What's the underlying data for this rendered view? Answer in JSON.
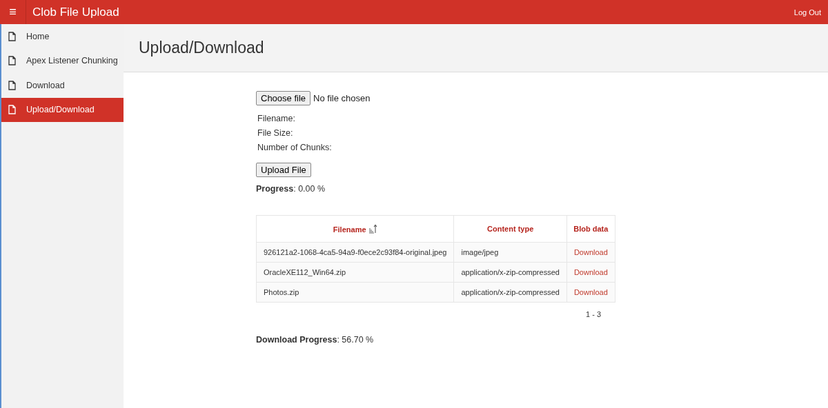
{
  "header": {
    "menu_glyph": "≡",
    "title": "Clob File Upload",
    "logout": "Log Out"
  },
  "sidebar": {
    "items": [
      {
        "label": "Home",
        "selected": false
      },
      {
        "label": "Apex Listener Chunking",
        "selected": false
      },
      {
        "label": "Download",
        "selected": false
      },
      {
        "label": "Upload/Download",
        "selected": true
      }
    ]
  },
  "page_title": "Upload/Download",
  "file_input": {
    "button": "Choose file",
    "status": "No file chosen"
  },
  "info_lines": [
    "Filename:",
    "File Size:",
    "Number of Chunks:"
  ],
  "upload_button": "Upload File",
  "progress": "**Progress**: 0.00 %",
  "table": {
    "columns": [
      {
        "label": "Filename",
        "sorted": true
      },
      {
        "label": "Content type",
        "sorted": false
      },
      {
        "label": "Blob data",
        "sorted": false
      }
    ],
    "rows": [
      [
        "926121a2-1068-4ca5-94a9-f0ece2c93f84-original.jpeg",
        "image/jpeg",
        "Download"
      ],
      [
        "OracleXE112_Win64.zip",
        "application/x-zip-compressed",
        "Download"
      ],
      [
        "Photos.zip",
        "application/x-zip-compressed",
        "Download"
      ]
    ],
    "pagination": "1 - 3"
  },
  "download_progress": "**Download Progress**: 56.70 %"
}
